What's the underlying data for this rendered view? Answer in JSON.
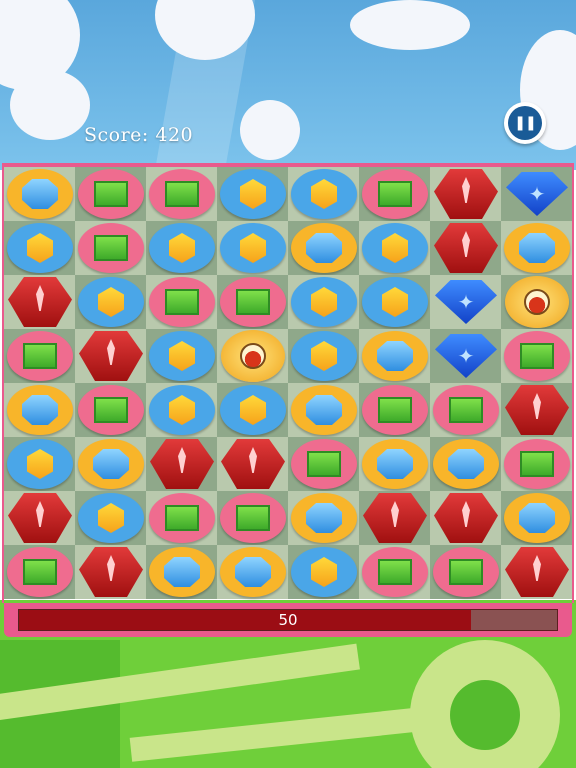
{
  "hud": {
    "score_text": "Score: 420",
    "pause_icon": "pause-icon",
    "progress_label": "50",
    "progress_fraction": 0.84
  },
  "colors": {
    "board_border": "#e95a8d",
    "bar_fill": "#9b0d14",
    "sky": "#6fb6e6",
    "ground": "#6fcf3a"
  },
  "gem_types": {
    "Y": "yellow-hexagon-gem",
    "G": "green-rectangle-gem",
    "B": "blue-octagon-gem",
    "R": "red-ruby-gem",
    "D": "blue-star-diamond",
    "P": "potion-bottle"
  },
  "board": {
    "rows": [
      [
        "B",
        "G",
        "G",
        "Y",
        "Y",
        "G",
        "R",
        "D"
      ],
      [
        "Y",
        "G",
        "Y",
        "Y",
        "B",
        "Y",
        "R",
        "B"
      ],
      [
        "R",
        "Y",
        "G",
        "G",
        "Y",
        "Y",
        "D",
        "P"
      ],
      [
        "G",
        "R",
        "Y",
        "P",
        "Y",
        "B",
        "D",
        "G"
      ],
      [
        "B",
        "G",
        "Y",
        "Y",
        "B",
        "G",
        "G",
        "R"
      ],
      [
        "Y",
        "B",
        "R",
        "R",
        "G",
        "B",
        "B",
        "G"
      ],
      [
        "R",
        "Y",
        "G",
        "G",
        "B",
        "R",
        "R",
        "B"
      ],
      [
        "G",
        "R",
        "B",
        "B",
        "Y",
        "G",
        "G",
        "R"
      ]
    ]
  }
}
